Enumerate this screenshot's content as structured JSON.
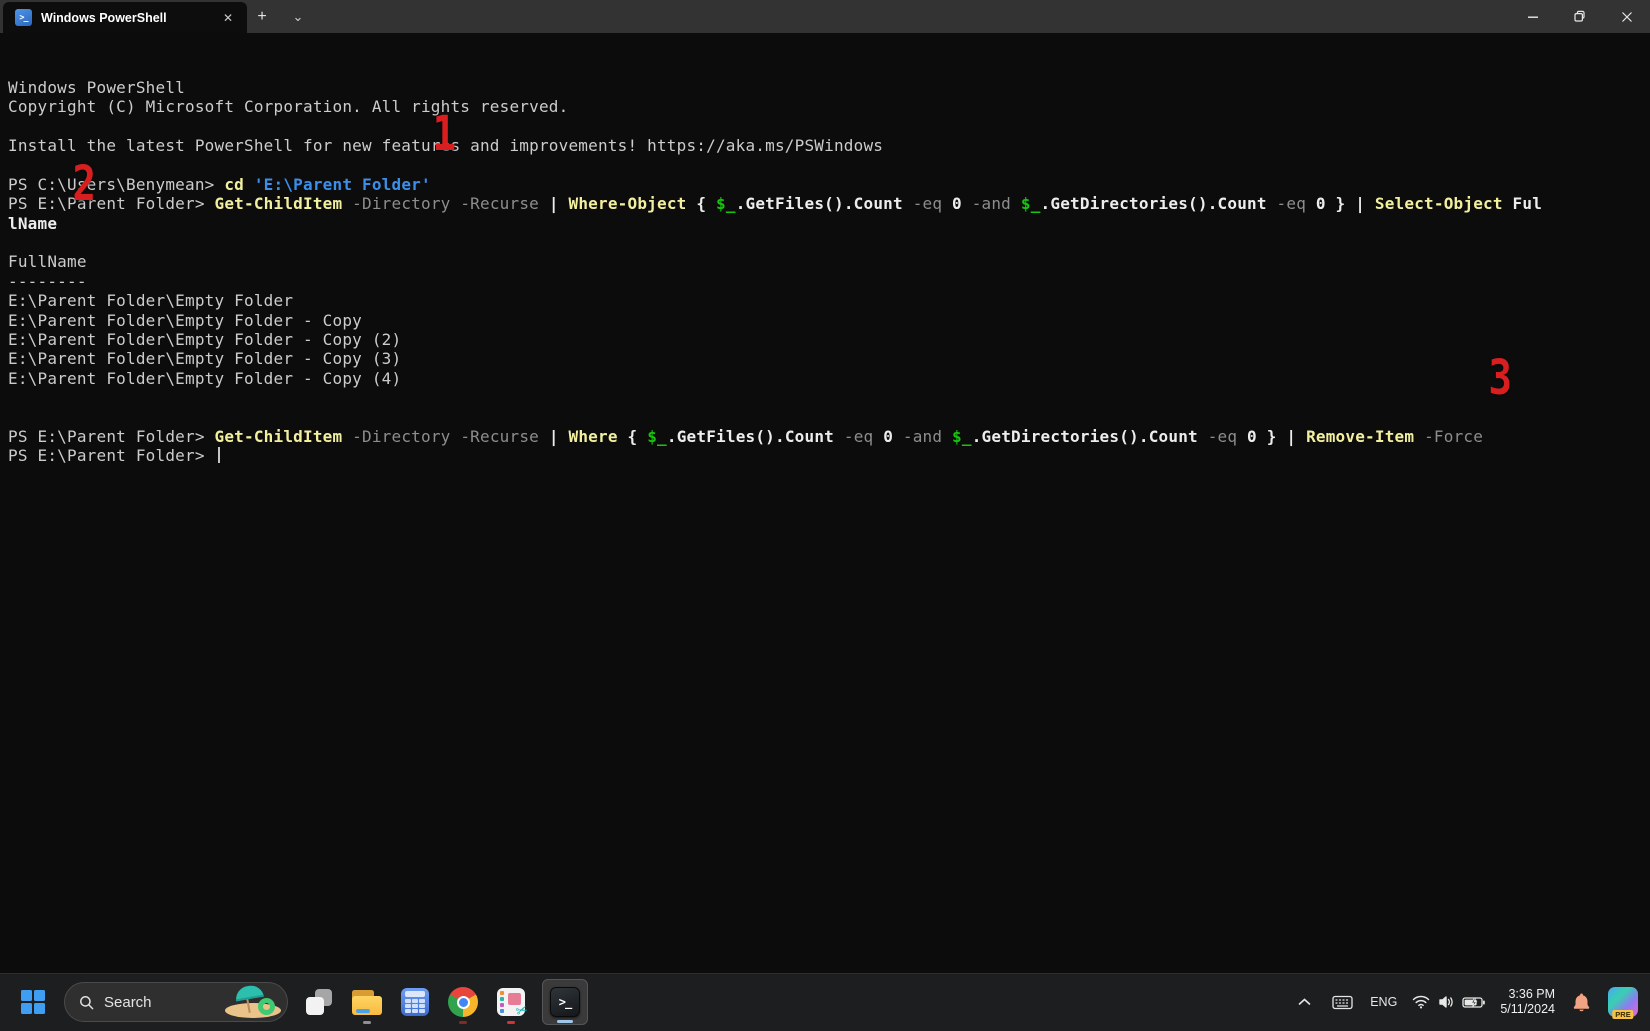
{
  "window": {
    "tab_title": "Windows PowerShell",
    "icons": {
      "tab_close": "✕",
      "new_tab": "+",
      "tab_dropdown": "⌄",
      "powershell_glyph": ">_"
    }
  },
  "terminal": {
    "colors": {
      "background": "#0c0c0c",
      "default_text": "#cccccc",
      "command": "#f2ef9f",
      "string": "#3b8eea",
      "parameter": "#8d8d8d",
      "variable": "#16c60c"
    },
    "cursor_visible": true,
    "lines": [
      [
        {
          "t": "Windows PowerShell",
          "c": "d"
        }
      ],
      [
        {
          "t": "Copyright (C) Microsoft Corporation. All rights reserved.",
          "c": "d"
        }
      ],
      [],
      [
        {
          "t": "Install the latest PowerShell for new features and improvements! https://aka.ms/PSWindows",
          "c": "d"
        }
      ],
      [],
      [
        {
          "t": "PS C:\\Users\\Benymean> ",
          "c": "d"
        },
        {
          "t": "cd",
          "c": "k"
        },
        {
          "t": " ",
          "c": "w"
        },
        {
          "t": "'E:\\Parent Folder'",
          "c": "s"
        }
      ],
      [
        {
          "t": "PS E:\\Parent Folder> ",
          "c": "d"
        },
        {
          "t": "Get-ChildItem",
          "c": "k"
        },
        {
          "t": " ",
          "c": "w"
        },
        {
          "t": "-Directory",
          "c": "p"
        },
        {
          "t": " ",
          "c": "w"
        },
        {
          "t": "-Recurse",
          "c": "p"
        },
        {
          "t": " | ",
          "c": "w"
        },
        {
          "t": "Where-Object",
          "c": "k"
        },
        {
          "t": " { ",
          "c": "w"
        },
        {
          "t": "$_",
          "c": "v"
        },
        {
          "t": ".GetFiles().Count ",
          "c": "w"
        },
        {
          "t": "-eq",
          "c": "p"
        },
        {
          "t": " 0 ",
          "c": "w"
        },
        {
          "t": "-and",
          "c": "p"
        },
        {
          "t": " ",
          "c": "w"
        },
        {
          "t": "$_",
          "c": "v"
        },
        {
          "t": ".GetDirectories().Count ",
          "c": "w"
        },
        {
          "t": "-eq",
          "c": "p"
        },
        {
          "t": " 0 } | ",
          "c": "w"
        },
        {
          "t": "Select-Object",
          "c": "k"
        },
        {
          "t": " Ful",
          "c": "w"
        }
      ],
      [
        {
          "t": "lName",
          "c": "w"
        }
      ],
      [],
      [
        {
          "t": "FullName",
          "c": "d"
        }
      ],
      [
        {
          "t": "--------",
          "c": "d"
        }
      ],
      [
        {
          "t": "E:\\Parent Folder\\Empty Folder",
          "c": "d"
        }
      ],
      [
        {
          "t": "E:\\Parent Folder\\Empty Folder - Copy",
          "c": "d"
        }
      ],
      [
        {
          "t": "E:\\Parent Folder\\Empty Folder - Copy (2)",
          "c": "d"
        }
      ],
      [
        {
          "t": "E:\\Parent Folder\\Empty Folder - Copy (3)",
          "c": "d"
        }
      ],
      [
        {
          "t": "E:\\Parent Folder\\Empty Folder - Copy (4)",
          "c": "d"
        }
      ],
      [],
      [],
      [
        {
          "t": "PS E:\\Parent Folder> ",
          "c": "d"
        },
        {
          "t": "Get-ChildItem",
          "c": "k"
        },
        {
          "t": " ",
          "c": "w"
        },
        {
          "t": "-Directory",
          "c": "p"
        },
        {
          "t": " ",
          "c": "w"
        },
        {
          "t": "-Recurse",
          "c": "p"
        },
        {
          "t": " | ",
          "c": "w"
        },
        {
          "t": "Where",
          "c": "k"
        },
        {
          "t": " { ",
          "c": "w"
        },
        {
          "t": "$_",
          "c": "v"
        },
        {
          "t": ".GetFiles().Count ",
          "c": "w"
        },
        {
          "t": "-eq",
          "c": "p"
        },
        {
          "t": " 0 ",
          "c": "w"
        },
        {
          "t": "-and",
          "c": "p"
        },
        {
          "t": " ",
          "c": "w"
        },
        {
          "t": "$_",
          "c": "v"
        },
        {
          "t": ".GetDirectories().Count ",
          "c": "w"
        },
        {
          "t": "-eq",
          "c": "p"
        },
        {
          "t": " 0 } | ",
          "c": "w"
        },
        {
          "t": "Remove-Item",
          "c": "k"
        },
        {
          "t": " ",
          "c": "w"
        },
        {
          "t": "-Force",
          "c": "p"
        }
      ],
      [
        {
          "t": "PS E:\\Parent Folder> ",
          "c": "d"
        }
      ]
    ]
  },
  "annotations": {
    "color": "#d81e1e",
    "labels": [
      "1",
      "2",
      "3"
    ]
  },
  "taskbar": {
    "search_placeholder": "Search",
    "language": "ENG",
    "clock": {
      "time": "3:36 PM",
      "date": "5/11/2024"
    },
    "copilot_badge": "PRE",
    "apps": [
      "start",
      "search",
      "task-view",
      "file-explorer",
      "calculator",
      "chrome",
      "clipchamp",
      "windows-terminal"
    ]
  }
}
